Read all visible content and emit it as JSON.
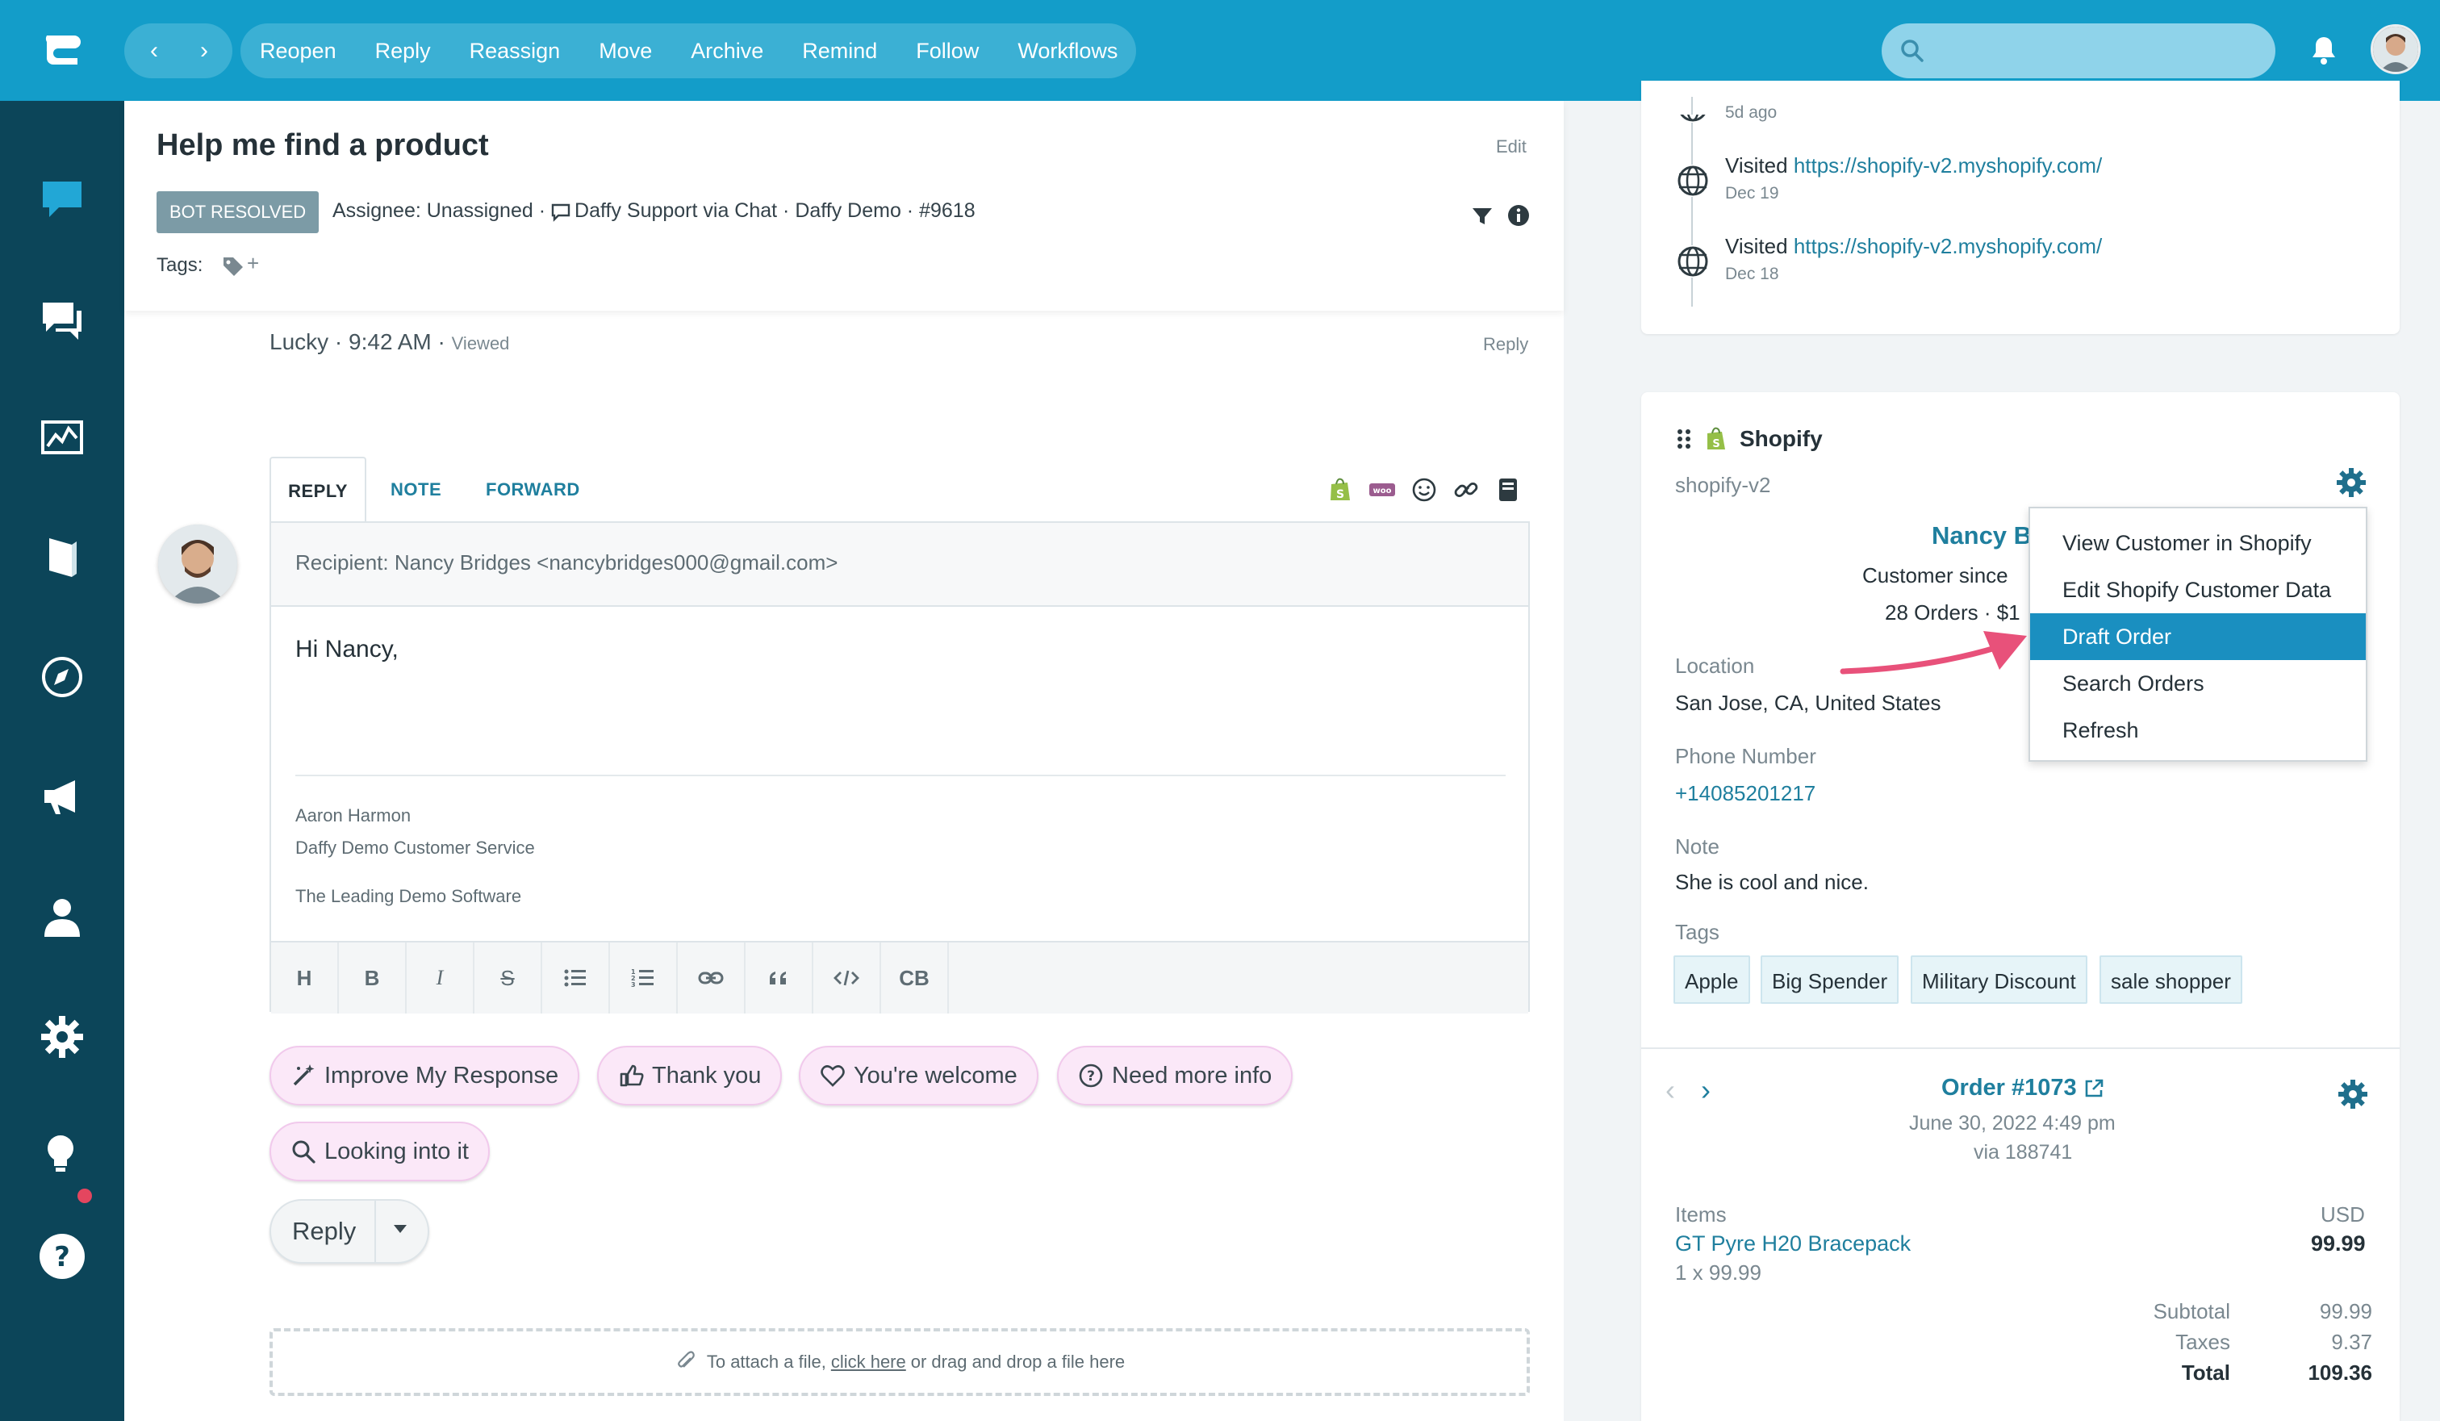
{
  "topbar": {
    "actions": [
      "Reopen",
      "Reply",
      "Reassign",
      "Move",
      "Archive",
      "Remind",
      "Follow",
      "Workflows"
    ],
    "search": {
      "value": "",
      "placeholder": ""
    }
  },
  "sidebar": {
    "items": [
      "chat-bubble",
      "conversations",
      "reports",
      "knowledge-base",
      "explore",
      "announcements",
      "contacts",
      "settings",
      "ideas",
      "help"
    ]
  },
  "ticket": {
    "title": "Help me find a product",
    "edit_label": "Edit",
    "status": "BOT RESOLVED",
    "meta_assignee": "Assignee: Unassigned ·",
    "meta_rest": "Daffy Support via Chat · Daffy Demo · #9618",
    "tags_label": "Tags:",
    "tag_add": "+"
  },
  "message": {
    "author_time": "Lucky · 9:42 AM ·",
    "status": "Viewed",
    "reply_label": "Reply"
  },
  "composer": {
    "tabs": [
      "REPLY",
      "NOTE",
      "FORWARD"
    ],
    "recipient": "Recipient: Nancy Bridges <nancybridges000@gmail.com>",
    "greeting": "Hi Nancy,",
    "signature": [
      "Aaron Harmon",
      "Daffy Demo Customer Service",
      "The Leading Demo Software"
    ],
    "format_buttons": [
      "H",
      "B",
      "I",
      "S",
      "ul",
      "ol",
      "link",
      "quote",
      "code",
      "CB"
    ]
  },
  "quick_replies": [
    "Improve My Response",
    "Thank you",
    "You're welcome",
    "Need more info",
    "Looking into it"
  ],
  "reply_button": "Reply",
  "attach": {
    "before": "To attach a file,",
    "link": "click here",
    "after": "or drag and drop a file here"
  },
  "visits": [
    {
      "text": "",
      "url": "",
      "date": "5d ago"
    },
    {
      "text": "Visited",
      "url": "https://shopify-v2.myshopify.com/",
      "date": "Dec 19"
    },
    {
      "text": "Visited",
      "url": "https://shopify-v2.myshopify.com/",
      "date": "Dec 18"
    }
  ],
  "shopify": {
    "title": "Shopify",
    "store": "shopify-v2",
    "customer_name": "Nancy B",
    "customer_since": "Customer since",
    "orders_summary": "28 Orders · $1",
    "location_label": "Location",
    "location": "San Jose, CA, United States",
    "phone_label": "Phone Number",
    "phone": "+14085201217",
    "note_label": "Note",
    "note": "She is cool and nice.",
    "tags_label": "Tags",
    "tags": [
      "Apple",
      "Big Spender",
      "Military Discount",
      "sale shopper"
    ]
  },
  "order": {
    "title": "Order #1073",
    "date": "June 30, 2022 4:49 pm",
    "via": "via 188741",
    "items_label": "Items",
    "currency": "USD",
    "item_name": "GT Pyre H20 Bracepack",
    "item_price": "99.99",
    "item_qty": "1 x 99.99",
    "subtotal_label": "Subtotal",
    "subtotal": "99.99",
    "taxes_label": "Taxes",
    "taxes": "9.37",
    "total_label": "Total",
    "total": "109.36"
  },
  "menu": {
    "items": [
      "View Customer in Shopify",
      "Edit Shopify Customer Data",
      "Draft Order",
      "Search Orders",
      "Refresh"
    ],
    "active_index": 2
  },
  "colors": {
    "topbar": "#139dc9",
    "sidebar": "#0c4559",
    "accent": "#1f7f9e",
    "menu_active": "#1a8fc0",
    "annotation_arrow": "#e8517a",
    "chip_bg": "#fbe8f8"
  }
}
